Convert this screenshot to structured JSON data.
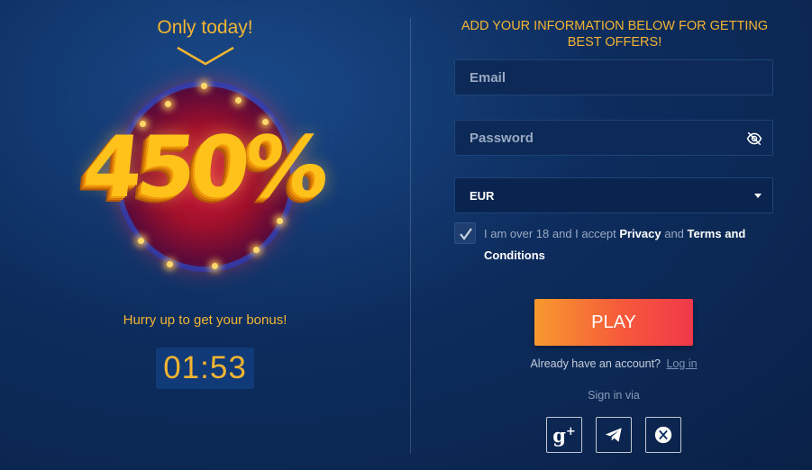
{
  "promo": {
    "headline": "Only today!",
    "bonus": "450%",
    "hurry_text": "Hurry up to get your bonus!",
    "timer": "01:53"
  },
  "form": {
    "title": "ADD YOUR INFORMATION BELOW FOR GETTING BEST OFFERS!",
    "email_placeholder": "Email",
    "password_placeholder": "Password",
    "currency": "EUR",
    "terms_prefix": "I am over 18 and I accept",
    "privacy_link": "Privacy",
    "terms_and": "and",
    "terms_link": "Terms and Conditions",
    "checkbox_checked": true,
    "play_label": "PLAY",
    "already_text": "Already have an account?",
    "login_link": "Log in",
    "signin_via": "Sign in via"
  },
  "social": {
    "google_glyph": "g",
    "google_plus": "+",
    "icons": [
      "google-plus-icon",
      "telegram-icon",
      "x-icon"
    ]
  },
  "colors": {
    "accent": "#f4b531",
    "play_start": "#f79a2e",
    "play_end": "#f0384a",
    "field_bg": "#0c2957"
  }
}
